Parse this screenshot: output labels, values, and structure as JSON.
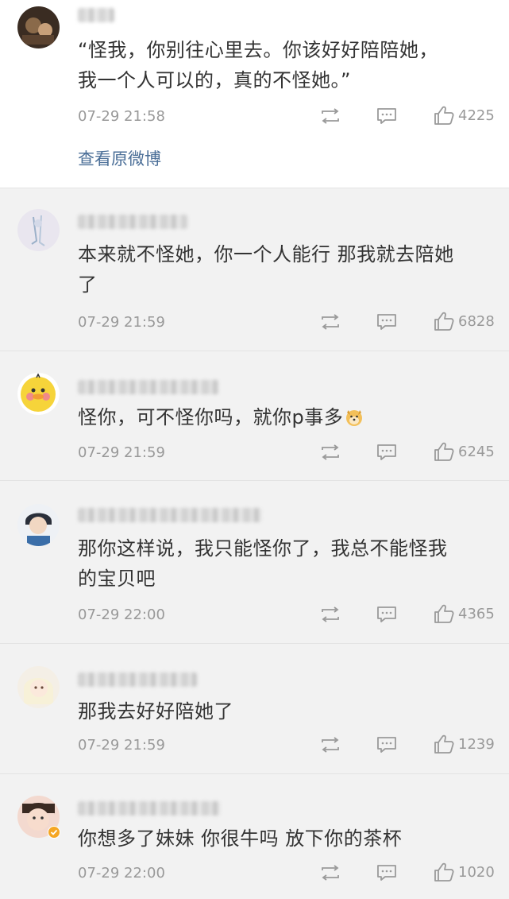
{
  "post": {
    "text": "“怪我，你别往心里去。你该好好陪陪她，\n我一个人可以的，真的不怪她。”",
    "time": "07-29 21:58",
    "likes": "4225",
    "view_original": "查看原微博"
  },
  "comments": [
    {
      "text": "本来就不怪她，你一个人能行 那我就去陪她\n了",
      "time": "07-29 21:59",
      "likes": "6828"
    },
    {
      "text": "怪你，可不怪你吗，就你p事多",
      "time": "07-29 21:59",
      "likes": "6245",
      "emoji": "doge-emoji"
    },
    {
      "text": "那你这样说，我只能怪你了，我总不能怪我\n的宝贝吧",
      "time": "07-29 22:00",
      "likes": "4365"
    },
    {
      "text": "那我去好好陪她了",
      "time": "07-29 21:59",
      "likes": "1239"
    },
    {
      "text": "你想多了妹妹 你很牛吗 放下你的茶杯",
      "time": "07-29 22:00",
      "likes": "1020"
    }
  ],
  "icons": {
    "repost": "repost-icon",
    "comment": "comment-icon",
    "like": "thumbs-up-icon"
  },
  "colors": {
    "link": "#4a6e97",
    "meta": "#999999",
    "text": "#333333",
    "verified": "#f5a623"
  }
}
